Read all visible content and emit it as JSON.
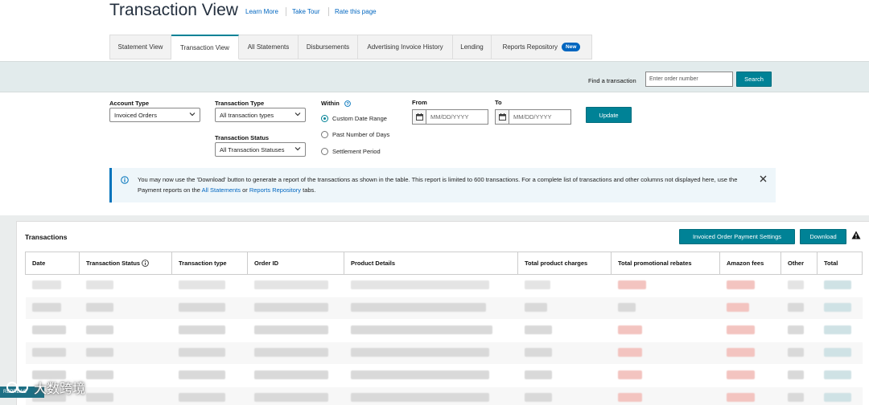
{
  "header": {
    "title": "Transaction View",
    "links": [
      "Learn More",
      "Take Tour",
      "Rate this page"
    ]
  },
  "tabs": [
    {
      "label": "Statement View",
      "active": false
    },
    {
      "label": "Transaction View",
      "active": true
    },
    {
      "label": "All Statements",
      "active": false
    },
    {
      "label": "Disbursements",
      "active": false
    },
    {
      "label": "Advertising Invoice History",
      "active": false
    },
    {
      "label": "Lending",
      "active": false
    },
    {
      "label": "Reports Repository",
      "active": false,
      "badge": "New"
    }
  ],
  "find": {
    "label": "Find a transaction",
    "placeholder": "Enter order number",
    "button": "Search"
  },
  "filters": {
    "account_type": {
      "label": "Account Type",
      "value": "Invoiced Orders"
    },
    "transaction_type": {
      "label": "Transaction Type",
      "value": "All transaction types"
    },
    "transaction_status": {
      "label": "Transaction Status",
      "value": "All Transaction Statuses"
    },
    "within": {
      "label": "Within",
      "options": [
        "Custom Date Range",
        "Past Number of Days",
        "Settlement Period"
      ],
      "selected": "Custom Date Range"
    },
    "from": {
      "label": "From",
      "placeholder": "MM/DD/YYYY"
    },
    "to": {
      "label": "To",
      "placeholder": "MM/DD/YYYY"
    },
    "update_button": "Update"
  },
  "alert": {
    "text_1": "You may now use the 'Download' button to generate a report of the transactions as shown in the table. This report is limited to 600 transactions. For a complete list of transactions and other columns not displayed here, use the Payment reports on the ",
    "link_1": "All Statements",
    "text_2": " or ",
    "link_2": "Reports Repository",
    "text_3": " tabs."
  },
  "transactions": {
    "title": "Transactions",
    "settings_button": "Invoiced Order Payment Settings",
    "download_button": "Download",
    "columns": [
      "Date",
      "Transaction Status",
      "Transaction type",
      "Order ID",
      "Product Details",
      "Total product charges",
      "Total promotional rebates",
      "Amazon fees",
      "Other",
      "Total"
    ]
  },
  "watermark": {
    "text": "大数跨境",
    "tag": "REPRBAC"
  },
  "colors": {
    "accent": "#008296",
    "link": "#0066c0",
    "badge": "#0066c0",
    "find_bar": "#e2ebec"
  }
}
